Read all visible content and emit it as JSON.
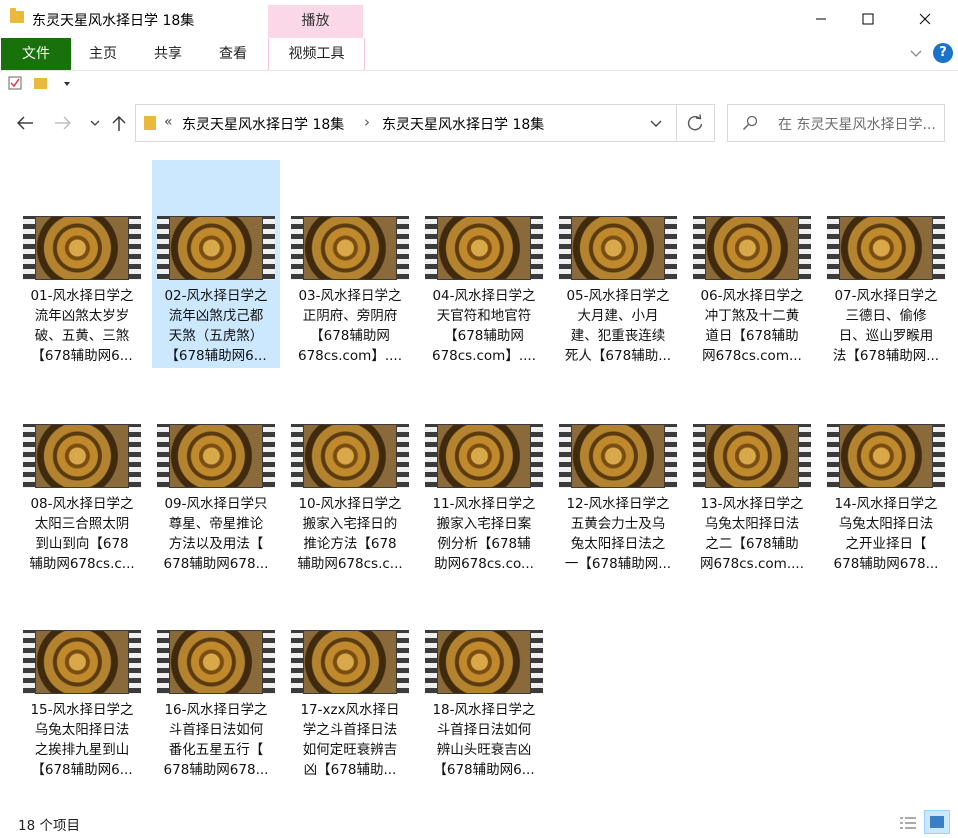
{
  "window": {
    "title": "东灵天星风水择日学 18集",
    "context_tab": "播放"
  },
  "ribbon": {
    "tabs": [
      "文件",
      "主页",
      "共享",
      "查看",
      "视频工具"
    ]
  },
  "address": {
    "prefix": "«",
    "crumb1": "东灵天星风水择日学 18集",
    "separator": "›",
    "crumb2": "东灵天星风水择日学 18集"
  },
  "search": {
    "placeholder": "在 东灵天星风水择日学..."
  },
  "files": [
    {
      "name": "01-风水择日学之\n流年凶煞太岁岁\n破、五黄、三煞\n【678辅助网6..."
    },
    {
      "name": "02-风水择日学之\n流年凶煞戊己都\n天煞（五虎煞）\n【678辅助网6...",
      "selected": true
    },
    {
      "name": "03-风水择日学之\n正阴府、旁阴府\n【678辅助网\n678cs.com】...."
    },
    {
      "name": "04-风水择日学之\n天官符和地官符\n【678辅助网\n678cs.com】...."
    },
    {
      "name": "05-风水择日学之\n大月建、小月\n建、犯重丧连续\n死人【678辅助..."
    },
    {
      "name": "06-风水择日学之\n冲丁煞及十二黄\n道日【678辅助\n网678cs.com..."
    },
    {
      "name": "07-风水择日学之\n三德日、偷修\n日、巡山罗睺用\n法【678辅助网..."
    },
    {
      "name": "08-风水择日学之\n太阳三合照太阴\n到山到向【678\n辅助网678cs.c..."
    },
    {
      "name": "09-风水择日学只\n尊星、帝星推论\n方法以及用法【\n678辅助网678..."
    },
    {
      "name": "10-风水择日学之\n搬家入宅择日的\n推论方法【678\n辅助网678cs.c..."
    },
    {
      "name": "11-风水择日学之\n搬家入宅择日案\n例分析【678辅\n助网678cs.co..."
    },
    {
      "name": "12-风水择日学之\n五黄会力士及乌\n兔太阳择日法之\n一【678辅助网..."
    },
    {
      "name": "13-风水择日学之\n乌兔太阳择日法\n之二【678辅助\n网678cs.com...."
    },
    {
      "name": "14-风水择日学之\n乌兔太阳择日法\n之开业择日【\n678辅助网678..."
    },
    {
      "name": "15-风水择日学之\n乌兔太阳择日法\n之挨排九星到山\n【678辅助网6..."
    },
    {
      "name": "16-风水择日学之\n斗首择日法如何\n番化五星五行【\n678辅助网678..."
    },
    {
      "name": "17-xzx风水择日\n学之斗首择日法\n如何定旺衰辨吉\n凶【678辅助..."
    },
    {
      "name": "18-风水择日学之\n斗首择日法如何\n辨山头旺衰吉凶\n【678辅助网6..."
    }
  ],
  "status": {
    "count": "18 个项目"
  },
  "colors": {
    "file_tab": "#19710b",
    "context_tab": "#fbd8e7",
    "selection": "#cce8ff",
    "help": "#1a73c8"
  }
}
